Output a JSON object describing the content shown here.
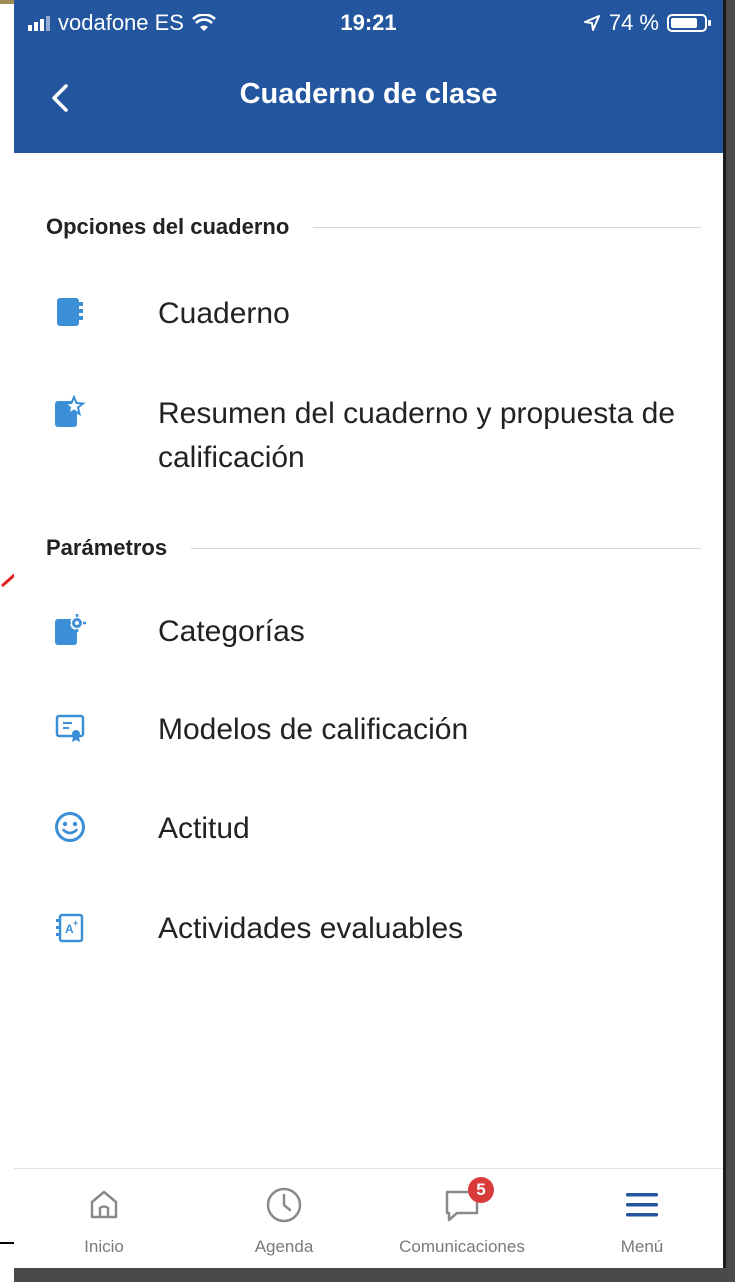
{
  "status_bar": {
    "carrier": "vodafone ES",
    "time": "19:21",
    "battery": "74 %"
  },
  "header": {
    "title": "Cuaderno de clase",
    "back_icon": "chevron-left-icon"
  },
  "sections": [
    {
      "label": "Opciones del cuaderno",
      "items": [
        {
          "label": "Cuaderno",
          "icon": "notebook-icon"
        },
        {
          "label": "Resumen del cuaderno y propuesta de calificación",
          "icon": "notebook-star-icon"
        }
      ]
    },
    {
      "label": "Parámetros",
      "items": [
        {
          "label": "Categorías",
          "icon": "notebook-gear-icon"
        },
        {
          "label": "Modelos de calificación",
          "icon": "certificate-icon"
        },
        {
          "label": "Actitud",
          "icon": "smiley-icon"
        },
        {
          "label": "Actividades evaluables",
          "icon": "grade-notebook-icon"
        }
      ]
    }
  ],
  "tabbar": {
    "items": [
      {
        "label": "Inicio",
        "icon": "home-icon"
      },
      {
        "label": "Agenda",
        "icon": "clock-icon"
      },
      {
        "label": "Comunicaciones",
        "icon": "chat-icon",
        "badge": "5"
      },
      {
        "label": "Menú",
        "icon": "menu-icon"
      }
    ]
  },
  "colors": {
    "header": "#2456a0",
    "icon": "#3a8fd6",
    "badge": "#d93a3a"
  }
}
